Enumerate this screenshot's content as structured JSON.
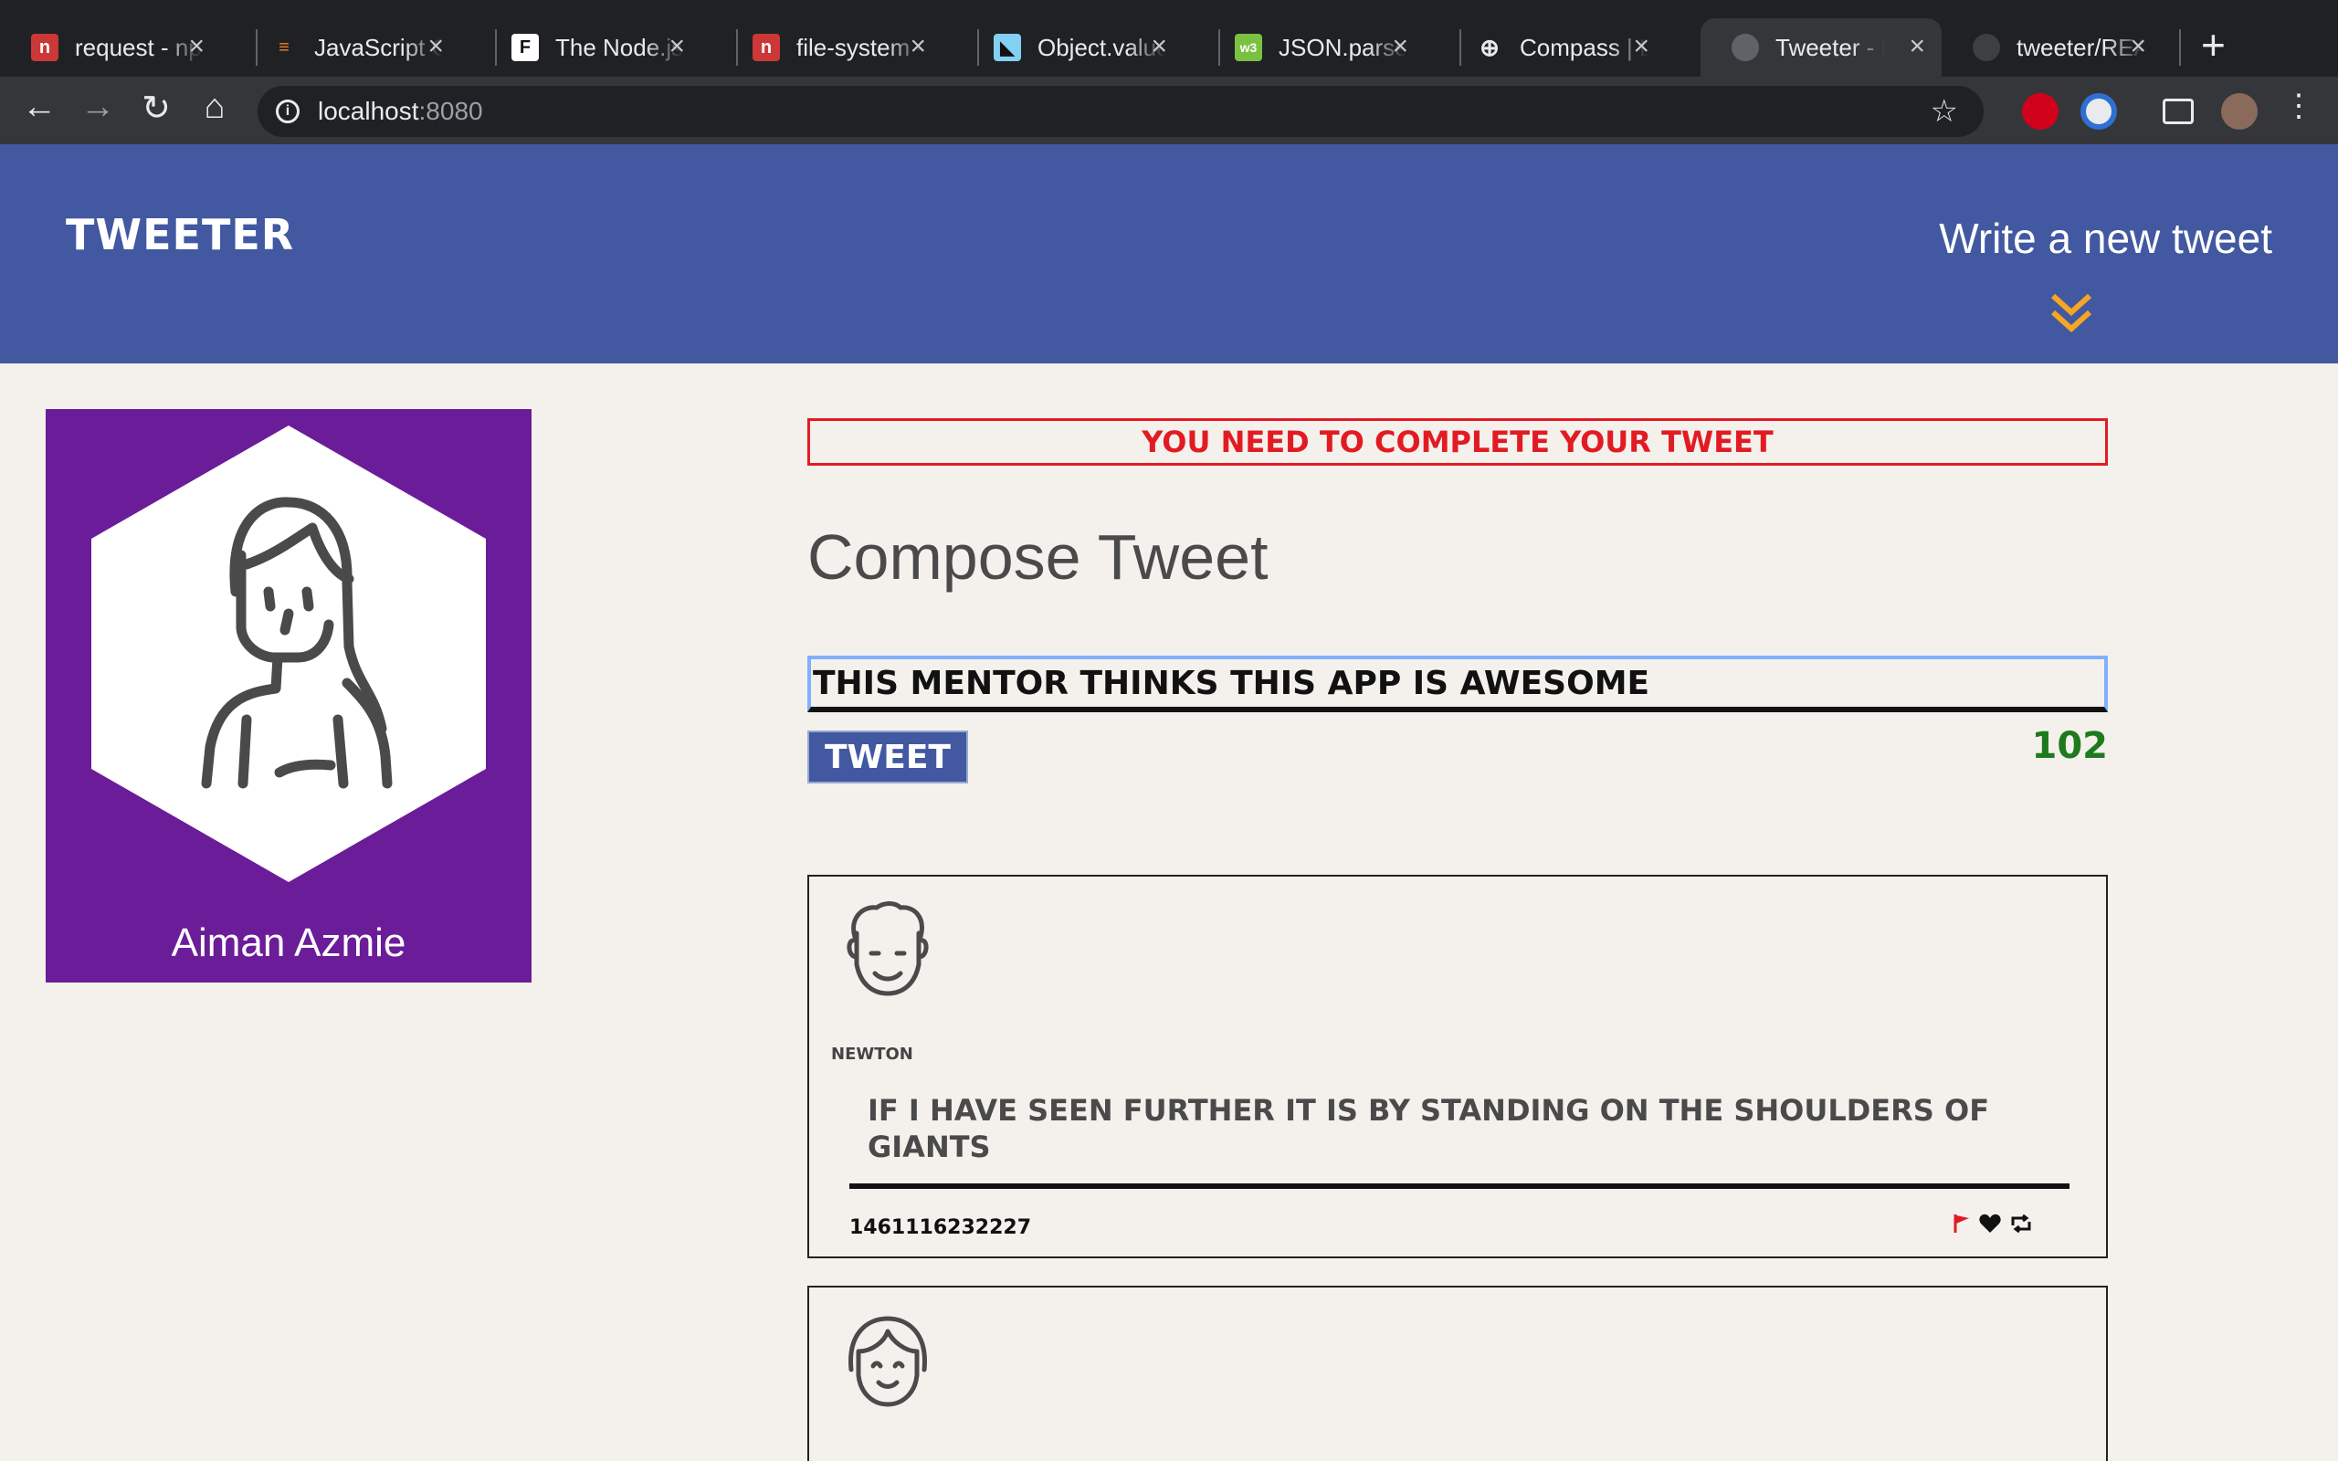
{
  "browser": {
    "tabs": [
      {
        "label": "request - npm",
        "favicon": "npm-icon",
        "color": "#cb3837",
        "glyph": "n"
      },
      {
        "label": "JavaScript Closures",
        "favicon": "stackoverflow-icon",
        "color": "#f48024",
        "glyph": "S"
      },
      {
        "label": "The Node.js",
        "favicon": "f-icon",
        "color": "#ffffff",
        "glyph": "F"
      },
      {
        "label": "file-system - npm",
        "favicon": "npm-icon",
        "color": "#cb3837",
        "glyph": "n"
      },
      {
        "label": "Object.values",
        "favicon": "mdn-icon",
        "color": "#83d0f2",
        "glyph": "m"
      },
      {
        "label": "JSON.parse",
        "favicon": "w3-icon",
        "color": "#7ac142",
        "glyph": "w3"
      },
      {
        "label": "Compass | Lighthouse",
        "favicon": "compass-icon",
        "color": "#202124",
        "glyph": "⊕"
      },
      {
        "label": "Tweeter - Home",
        "favicon": "globe-icon",
        "color": "#5f6368",
        "glyph": "◍"
      },
      {
        "label": "tweeter/README",
        "favicon": "github-icon",
        "color": "#202124",
        "glyph": "●"
      }
    ],
    "new_tab": "+",
    "url_host": "localhost",
    "url_port": ":8080"
  },
  "header": {
    "brand": "TWEETER",
    "write_link": "Write a new tweet",
    "accent": "#f5a623"
  },
  "profile": {
    "name": "Aiman Azmie",
    "bg": "#6b1c99"
  },
  "compose": {
    "error": "YOU NEED TO COMPLETE YOUR TWEET",
    "title": "Compose Tweet",
    "input_value": "THIS MENTOR THINKS THIS APP IS AWESOME",
    "button": "TWEET",
    "counter": "102"
  },
  "tweets": [
    {
      "handle": "NEWTON",
      "text": "IF I HAVE SEEN FURTHER IT IS BY STANDING ON THE SHOULDERS OF GIANTS",
      "timestamp": "1461116232227",
      "actions": [
        "flag-icon",
        "heart-icon",
        "retweet-icon"
      ]
    }
  ]
}
